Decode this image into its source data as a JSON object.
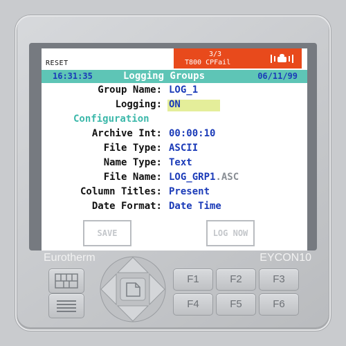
{
  "status": {
    "reset_label": "RESET",
    "alarm_count": "3/3",
    "alarm_message": "T800 CPFail",
    "alarm_icon": "alarm-bell-icon",
    "alarm_color": "#e84a1c"
  },
  "titlebar": {
    "time": "16:31:35",
    "title": "Logging Groups",
    "date": "06/11/99",
    "color": "#5ec5b6"
  },
  "fields": {
    "group_name": {
      "label": "Group Name:",
      "value": "LOG_1"
    },
    "logging": {
      "label": "Logging:",
      "value": "ON"
    },
    "section": "Configuration",
    "archive_int": {
      "label": "Archive Int:",
      "value": "00:00:10"
    },
    "file_type": {
      "label": "File Type:",
      "value": "ASCII"
    },
    "name_type": {
      "label": "Name Type:",
      "value": "Text"
    },
    "file_name": {
      "label": "File Name:",
      "value": "LOG_GRP1",
      "ext": ".ASC"
    },
    "column_titles": {
      "label": "Column Titles:",
      "value": "Present"
    },
    "date_format": {
      "label": "Date Format:",
      "value": "Date Time"
    }
  },
  "softkeys": {
    "save": "SAVE",
    "log_now": "LOG NOW"
  },
  "device": {
    "brand": "Eurotherm",
    "model": "EYCON10",
    "function_keys": [
      "F1",
      "F2",
      "F3",
      "F4",
      "F5",
      "F6"
    ],
    "icons": [
      "grid-key-icon",
      "menu-lines-icon",
      "page-icon"
    ]
  }
}
